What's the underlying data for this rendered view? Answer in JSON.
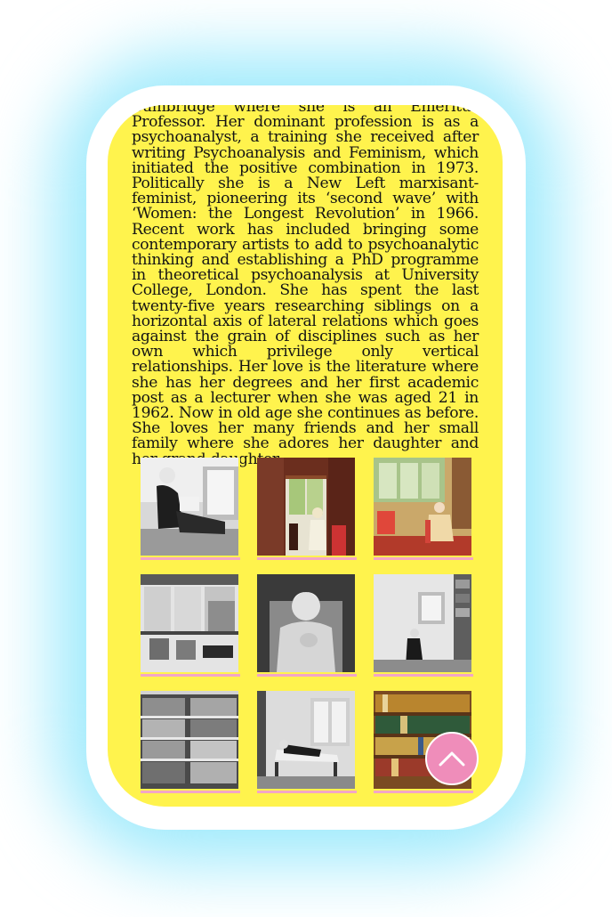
{
  "bio": {
    "text": "Cambridge where she is an Emeritus Professor. Her dominant profession is as a psychoanalyst, a training she received after writing Psychoanalysis and Feminism, which initiated the positive combination in 1973. Politically she is a New Left marxisant- feminist, pioneering its ‘second wave’ with ‘Women: the Longest Revolution’ in 1966. Recent work has included bringing some contemporary artists to add to psychoanalytic thinking and establishing a PhD programme in theoretical psychoanalysis at University College, London. She has spent the last twenty-five years researching siblings on a horizontal axis of lateral relations which goes against the grain of disciplines such as her own which privilege only vertical relationships. Her love is the literature where she has her degrees and her first academic post as a lecturer when she was aged 21 in 1962. Now in old age she continues as before. She loves her many friends and her small family where she adores her daughter and her grand-daughter."
  },
  "gallery": {
    "photos": [
      {
        "name": "woman-reading-on-daybed",
        "color": "grayscale"
      },
      {
        "name": "woman-in-doorway",
        "color": "color"
      },
      {
        "name": "woman-seated-in-room",
        "color": "color"
      },
      {
        "name": "conservatory-chairs",
        "color": "grayscale"
      },
      {
        "name": "woman-smiling-portrait",
        "color": "grayscale"
      },
      {
        "name": "woman-by-window",
        "color": "grayscale"
      },
      {
        "name": "bookshelves",
        "color": "grayscale"
      },
      {
        "name": "woman-lying-on-chaise",
        "color": "grayscale"
      },
      {
        "name": "bookshelves-color",
        "color": "color"
      }
    ]
  },
  "scroll_top_button": {
    "icon": "chevron-up-icon"
  },
  "colors": {
    "page_bg": "#fff34d",
    "accent": "#ef8dba",
    "glow": "#9eeafc"
  }
}
